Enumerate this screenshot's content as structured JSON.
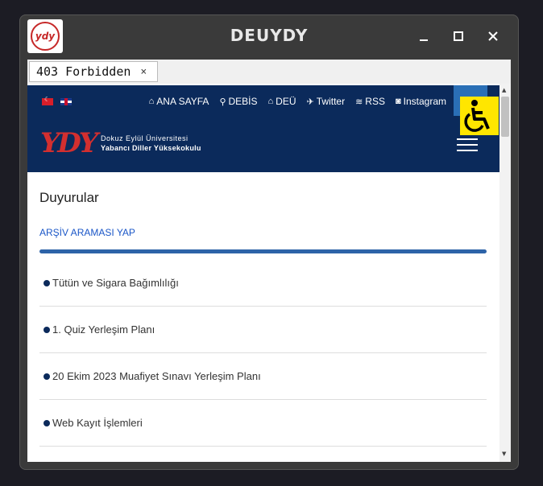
{
  "window": {
    "title": "DEUYDY",
    "logo_text": "ydy",
    "controls": {
      "minimize": "minimize",
      "maximize": "maximize",
      "close": "close"
    }
  },
  "tab": {
    "label": "403 Forbidden",
    "close_glyph": "×"
  },
  "topnav": {
    "flags": [
      "tr-flag",
      "uk-flag"
    ],
    "links": [
      {
        "icon": "⌂",
        "label": "ANA SAYFA"
      },
      {
        "icon": "⚲",
        "label": "DEBİS"
      },
      {
        "icon": "⌂",
        "label": "DEÜ"
      },
      {
        "icon": "✈",
        "label": "Twitter"
      },
      {
        "icon": "≋",
        "label": "RSS"
      },
      {
        "icon": "◙",
        "label": "Instagram"
      }
    ]
  },
  "header": {
    "logo_mark": "YDY",
    "logo_line1": "Dokuz Eylül Üniversitesi",
    "logo_line2": "Yabancı Diller Yüksekokulu"
  },
  "main": {
    "heading": "Duyurular",
    "archive_link": "ARŞİV ARAMASI YAP",
    "items": [
      "Tütün ve Sigara Bağımlılığı",
      "1. Quiz Yerleşim Planı",
      "20 Ekim 2023 Muafiyet Sınavı Yerleşim Planı",
      "Web Kayıt İşlemleri"
    ]
  },
  "colors": {
    "nav_bg": "#0b2a5b",
    "accent": "#2d63a8",
    "accessibility": "#ffe600"
  }
}
